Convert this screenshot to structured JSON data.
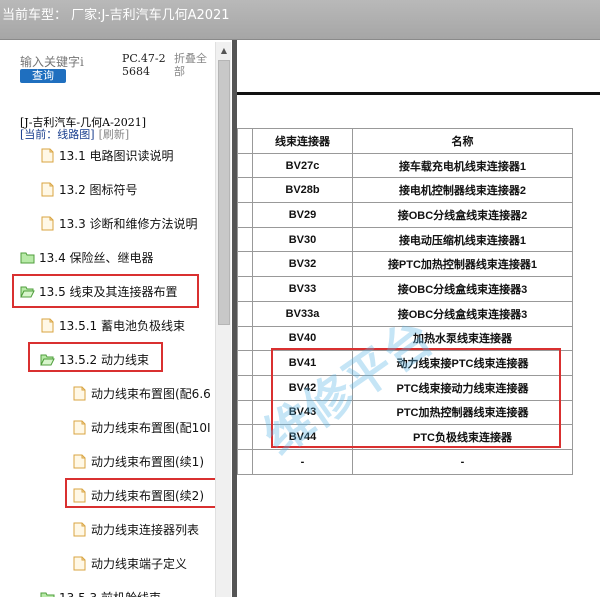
{
  "window": {
    "title": "当前车型： 厂家:J-吉利汽车几何A2021"
  },
  "search": {
    "placeholder": "输入关键字i",
    "button_label": "查询"
  },
  "pc_code": "PC.47-25684",
  "collapse_all_label": "折叠全部",
  "vehicle_label": "[J-吉利汽车-几何A-2021]",
  "current": {
    "label": "[当前：线路图]",
    "refresh": "[刷新]"
  },
  "tree": [
    {
      "label": "13.1 电路图识读说明",
      "icon": "document-icon"
    },
    {
      "label": "13.2 图标符号",
      "icon": "document-icon"
    },
    {
      "label": "13.3 诊断和维修方法说明",
      "icon": "document-icon"
    },
    {
      "label": "13.4 保险丝、继电器",
      "icon": "folder-icon"
    },
    {
      "label": "13.5 线束及其连接器布置",
      "icon": "folder-open-icon"
    },
    {
      "label": "13.5.1 蓄电池负极线束",
      "icon": "document-icon"
    },
    {
      "label": "13.5.2 动力线束",
      "icon": "folder-open-icon"
    },
    {
      "label": "动力线束布置图(配6.6",
      "icon": "document-icon"
    },
    {
      "label": "动力线束布置图(配10I",
      "icon": "document-icon"
    },
    {
      "label": "动力线束布置图(续1)",
      "icon": "document-icon"
    },
    {
      "label": "动力线束布置图(续2)",
      "icon": "document-icon"
    },
    {
      "label": "动力线束连接器列表",
      "icon": "document-icon"
    },
    {
      "label": "动力线束端子定义",
      "icon": "document-icon"
    },
    {
      "label": "13.5.3 前机舱线束",
      "icon": "folder-icon"
    }
  ],
  "table": {
    "headers": [
      "线束连接器",
      "名称"
    ],
    "rows": [
      [
        "BV27c",
        "接车载充电机线束连接器1"
      ],
      [
        "BV28b",
        "接电机控制器线束连接器2"
      ],
      [
        "BV29",
        "接OBC分线盒线束连接器2"
      ],
      [
        "BV30",
        "接电动压缩机线束连接器1"
      ],
      [
        "BV32",
        "接PTC加热控制器线束连接器1"
      ],
      [
        "BV33",
        "接OBC分线盒线束连接器3"
      ],
      [
        "BV33a",
        "接OBC分线盒线束连接器3"
      ],
      [
        "BV40",
        "加热水泵线束连接器"
      ],
      [
        "BV41",
        "动力线束接PTC线束连接器"
      ],
      [
        "BV42",
        "PTC线束接动力线束连接器"
      ],
      [
        "BV43",
        "PTC加热控制器线束连接器"
      ],
      [
        "BV44",
        "PTC负极线束连接器"
      ],
      [
        "-",
        "-"
      ]
    ]
  },
  "watermark": "维修平台",
  "colors": {
    "highlight": "#d93030",
    "folder": "#7ed36b",
    "document": "#f5c978",
    "search_button": "#1f6fbf"
  }
}
